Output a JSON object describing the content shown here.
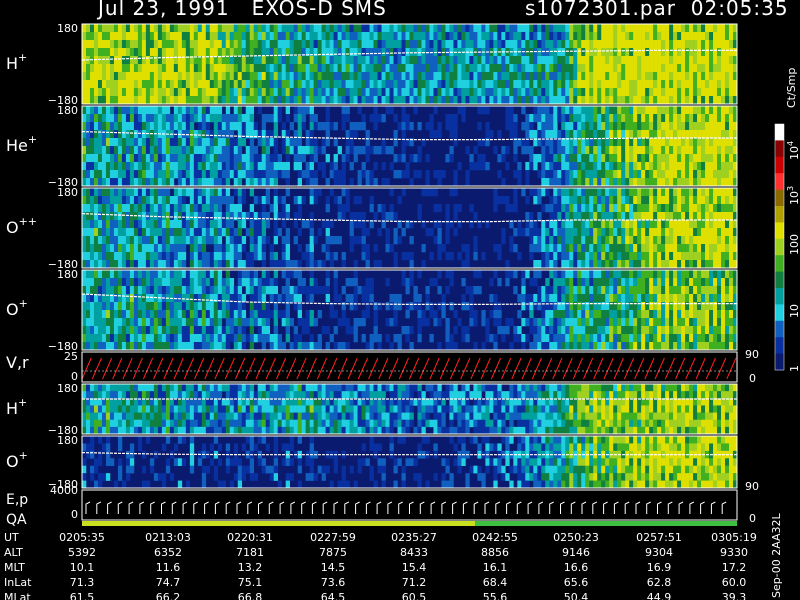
{
  "header": {
    "date": "Jul 23, 1991",
    "instrument": "EXOS-D SMS",
    "file": "s1072301.par",
    "time": "02:05:35"
  },
  "colors": {
    "background": "#000000",
    "bg_fill": "#0a1a6e",
    "axis": "#ffffff",
    "trace": "#ffffff",
    "vr_trace": "#ff2020",
    "ep_trace": "#ffffff",
    "qa_good": "#c8e020",
    "qa_ok": "#40c040"
  },
  "panels": [
    {
      "id": "h-plus",
      "label": "H",
      "sup": "+",
      "ymax": "180",
      "ymin": "−180",
      "rows": 10
    },
    {
      "id": "he-plus",
      "label": "He",
      "sup": "+",
      "ymax": "180",
      "ymin": "−180",
      "rows": 10
    },
    {
      "id": "o-plusplus",
      "label": "O",
      "sup": "++",
      "ymax": "180",
      "ymin": "−180",
      "rows": 10
    },
    {
      "id": "o-plus",
      "label": "O",
      "sup": "+",
      "ymax": "180",
      "ymin": "−180",
      "rows": 10
    },
    {
      "id": "h-plus-2",
      "label": "H",
      "sup": "+",
      "ymax": "180",
      "ymin": "−180",
      "rows": 7
    },
    {
      "id": "o-plus-2",
      "label": "O",
      "sup": "+",
      "ymax": "180",
      "ymin": "−180",
      "rows": 7
    }
  ],
  "vr_panel": {
    "label": "V,r",
    "ymax": "25",
    "ymid": "0",
    "right_top": "90",
    "right_bottom": "0"
  },
  "ep_panel": {
    "label1": "E,p",
    "label2": "QA",
    "ymax": "4000",
    "ymid": "0",
    "right_top": "90",
    "right_bottom": "0"
  },
  "colorbar": {
    "unit": "Ct/Smp",
    "labels": [
      "10",
      "10",
      "100",
      "10",
      "1"
    ],
    "label_sups": [
      "4",
      "3",
      "",
      "",
      ""
    ],
    "stops": [
      "#ffffff",
      "#8b0000",
      "#cc0000",
      "#ff3030",
      "#8b6b00",
      "#b0a000",
      "#e0e000",
      "#a0d020",
      "#40b020",
      "#108040",
      "#00a0a0",
      "#20d0e0",
      "#1060c0",
      "#0830a0",
      "#0a1a6e"
    ]
  },
  "chart_data": {
    "type": "heatmap",
    "title": "Jul 23, 1991   EXOS-D SMS",
    "time_axis": {
      "ticks": [
        "0205:35",
        "0213:03",
        "0220:31",
        "0227:59",
        "0235:27",
        "0242:55",
        "0250:23",
        "0257:51",
        "0305:19"
      ]
    },
    "activity_profiles": {
      "h-plus": {
        "x": [
          0,
          0.1,
          0.2,
          0.3,
          0.45,
          0.55,
          0.65,
          0.74,
          0.76,
          0.85,
          1.0
        ],
        "y": [
          0.85,
          0.85,
          0.8,
          0.5,
          0.45,
          0.45,
          0.45,
          0.5,
          0.9,
          0.9,
          0.9
        ]
      },
      "he-plus": {
        "x": [
          0,
          0.1,
          0.2,
          0.3,
          0.45,
          0.55,
          0.65,
          0.72,
          0.8,
          0.87,
          1.0
        ],
        "y": [
          0.45,
          0.4,
          0.35,
          0.2,
          0.1,
          0.05,
          0.05,
          0.35,
          0.6,
          0.85,
          0.9
        ]
      },
      "o-plusplus": {
        "x": [
          0,
          0.1,
          0.2,
          0.3,
          0.45,
          0.55,
          0.65,
          0.72,
          0.8,
          0.87,
          1.0
        ],
        "y": [
          0.45,
          0.4,
          0.3,
          0.15,
          0.08,
          0.05,
          0.05,
          0.35,
          0.55,
          0.8,
          0.85
        ]
      },
      "o-plus": {
        "x": [
          0,
          0.1,
          0.2,
          0.3,
          0.45,
          0.55,
          0.65,
          0.72,
          0.8,
          0.87,
          1.0
        ],
        "y": [
          0.45,
          0.45,
          0.35,
          0.2,
          0.12,
          0.08,
          0.1,
          0.4,
          0.5,
          0.7,
          0.75
        ]
      },
      "h-plus-2": {
        "x": [
          0,
          0.1,
          0.2,
          0.35,
          0.45,
          0.55,
          0.65,
          0.72,
          0.76,
          0.85,
          1.0
        ],
        "y": [
          0.5,
          0.45,
          0.35,
          0.45,
          0.35,
          0.3,
          0.3,
          0.5,
          0.7,
          0.75,
          0.8
        ]
      },
      "o-plus-2": {
        "x": [
          0,
          0.1,
          0.2,
          0.3,
          0.45,
          0.55,
          0.65,
          0.72,
          0.78,
          0.85,
          1.0
        ],
        "y": [
          0.05,
          0.05,
          0.05,
          0.05,
          0.05,
          0.1,
          0.25,
          0.5,
          0.65,
          0.85,
          0.85
        ]
      }
    },
    "trace_levels": {
      "h-plus": [
        0.45,
        0.42,
        0.4,
        0.38,
        0.36,
        0.35,
        0.34,
        0.33,
        0.33
      ],
      "he-plus": [
        0.32,
        0.35,
        0.38,
        0.4,
        0.42,
        0.42,
        0.41,
        0.4,
        0.4
      ],
      "o-plusplus": [
        0.32,
        0.36,
        0.38,
        0.4,
        0.42,
        0.42,
        0.4,
        0.4,
        0.4
      ],
      "o-plus": [
        0.3,
        0.35,
        0.4,
        0.42,
        0.43,
        0.43,
        0.42,
        0.42,
        0.42
      ],
      "h-plus-2": [
        0.3,
        0.3,
        0.3,
        0.3,
        0.3,
        0.3,
        0.3,
        0.3,
        0.3
      ],
      "o-plus-2": [
        0.32,
        0.35,
        0.36,
        0.36,
        0.36,
        0.36,
        0.36,
        0.36,
        0.36
      ]
    },
    "orbit_table": {
      "rows": [
        {
          "name": "UT",
          "values": [
            "0205:35",
            "0213:03",
            "0220:31",
            "0227:59",
            "0235:27",
            "0242:55",
            "0250:23",
            "0257:51",
            "0305:19"
          ]
        },
        {
          "name": "ALT",
          "values": [
            "5392",
            "6352",
            "7181",
            "7875",
            "8433",
            "8856",
            "9146",
            "9304",
            "9330"
          ]
        },
        {
          "name": "MLT",
          "values": [
            "10.1",
            "11.6",
            "13.2",
            "14.5",
            "15.4",
            "16.1",
            "16.6",
            "16.9",
            "17.2"
          ]
        },
        {
          "name": "InLat",
          "values": [
            "71.3",
            "74.7",
            "75.1",
            "73.6",
            "71.2",
            "68.4",
            "65.6",
            "62.8",
            "60.0"
          ]
        },
        {
          "name": "MLat",
          "values": [
            "61.5",
            "66.2",
            "66.8",
            "64.5",
            "60.5",
            "55.6",
            "50.4",
            "44.9",
            "39.3"
          ]
        }
      ]
    }
  },
  "footer": {
    "stamp": "Sep-00  2AA32L"
  }
}
